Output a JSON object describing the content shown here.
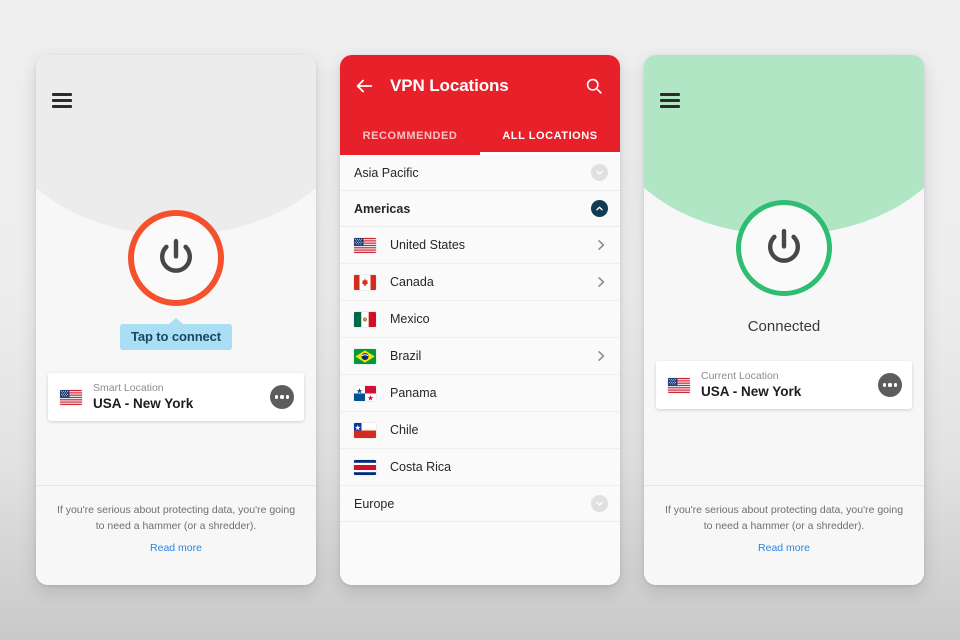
{
  "colors": {
    "brand_red": "#E8202A",
    "power_off_ring": "#F4512C",
    "power_on_ring": "#2FBD72",
    "hero_green": "#B0E6C4",
    "tooltip_bg": "#AADEF5",
    "tooltip_text": "#19485C",
    "link_blue": "#2E86D8",
    "expanded_toggle": "#143A52"
  },
  "panel_disconnected": {
    "menu_icon": "hamburger-menu-icon",
    "power_icon": "power-icon",
    "tooltip": "Tap to connect",
    "location_card": {
      "flag": "us-flag-icon",
      "label": "Smart Location",
      "name": "USA - New York",
      "more_icon": "more-options-icon"
    },
    "promo": {
      "text": "If you're serious about protecting data, you're going to need a hammer (or a shredder).",
      "link": "Read more"
    }
  },
  "panel_locations": {
    "back_icon": "back-arrow-icon",
    "title": "VPN Locations",
    "search_icon": "search-icon",
    "tabs": [
      {
        "label": "RECOMMENDED",
        "active": false
      },
      {
        "label": "ALL LOCATIONS",
        "active": true
      }
    ],
    "regions": [
      {
        "name": "Asia Pacific",
        "expanded": false,
        "toggle_icon": "chevron-down-icon"
      },
      {
        "name": "Americas",
        "expanded": true,
        "toggle_icon": "chevron-up-icon"
      },
      {
        "name": "Europe",
        "expanded": false,
        "toggle_icon": "chevron-down-icon"
      }
    ],
    "countries": [
      {
        "name": "United States",
        "flag": "us-flag-icon",
        "has_chevron": true
      },
      {
        "name": "Canada",
        "flag": "ca-flag-icon",
        "has_chevron": true
      },
      {
        "name": "Mexico",
        "flag": "mx-flag-icon",
        "has_chevron": false
      },
      {
        "name": "Brazil",
        "flag": "br-flag-icon",
        "has_chevron": true
      },
      {
        "name": "Panama",
        "flag": "pa-flag-icon",
        "has_chevron": false
      },
      {
        "name": "Chile",
        "flag": "cl-flag-icon",
        "has_chevron": false
      },
      {
        "name": "Costa Rica",
        "flag": "cr-flag-icon",
        "has_chevron": false
      }
    ]
  },
  "panel_connected": {
    "menu_icon": "hamburger-menu-icon",
    "power_icon": "power-icon",
    "status": "Connected",
    "location_card": {
      "flag": "us-flag-icon",
      "label": "Current Location",
      "name": "USA - New York",
      "more_icon": "more-options-icon"
    },
    "promo": {
      "text": "If you're serious about protecting data, you're going to need a hammer (or a shredder).",
      "link": "Read more"
    }
  }
}
